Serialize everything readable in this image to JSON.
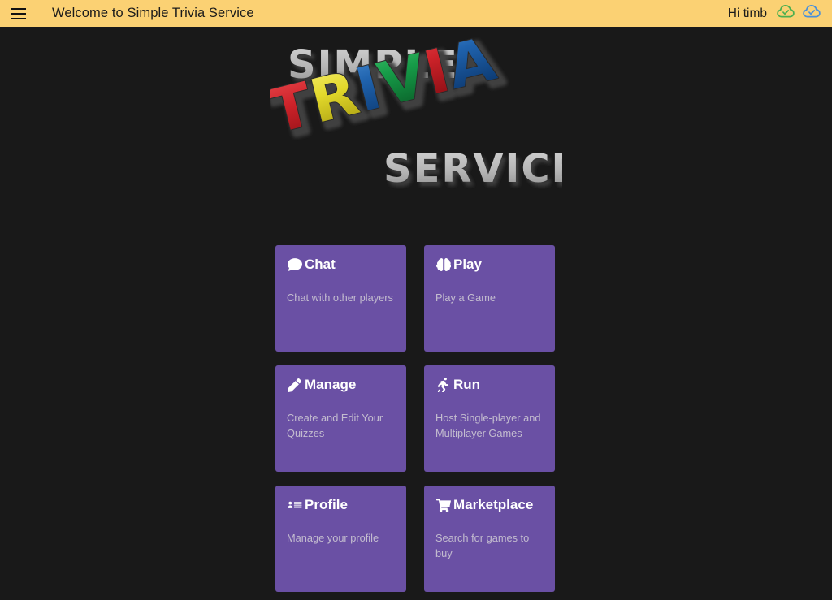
{
  "header": {
    "menu_icon": "hamburger-menu-icon",
    "title": "Welcome to Simple Trivia Service",
    "greeting": "Hi timb",
    "status_icons": [
      {
        "name": "cloud-check-green-icon",
        "color": "#4caf50"
      },
      {
        "name": "cloud-check-blue-icon",
        "color": "#4a90d9"
      }
    ],
    "background_color": "#fbd173",
    "text_color": "#1b1b1b"
  },
  "logo": {
    "line1": "SIMPLE",
    "line2": "TRIVIA",
    "line3": "SERVICE",
    "gray_color": "#b5b5b5",
    "letter_colors": [
      "#cc2229",
      "#e3d92b",
      "#1f62ad",
      "#169b48",
      "#cc2229",
      "#1f62ad"
    ],
    "shadow_color": "#4a4a4a"
  },
  "cards": [
    {
      "title": "Chat",
      "desc": "Chat with other players",
      "icon": "comment-icon"
    },
    {
      "title": "Play",
      "desc": "Play a Game",
      "icon": "brain-icon"
    },
    {
      "title": "Manage",
      "desc": "Create and Edit Your Quizzes",
      "icon": "pencil-icon"
    },
    {
      "title": "Run",
      "desc": "Host Single-player and Multiplayer Games",
      "icon": "running-person-icon"
    },
    {
      "title": "Profile",
      "desc": "Manage your profile",
      "icon": "user-list-icon"
    },
    {
      "title": "Marketplace",
      "desc": "Search for games to buy",
      "icon": "shopping-cart-icon"
    }
  ],
  "theme": {
    "page_background": "#191919",
    "card_background": "#6a50a4",
    "card_title_color": "#ffffff",
    "card_desc_color": "#c3bccf"
  }
}
